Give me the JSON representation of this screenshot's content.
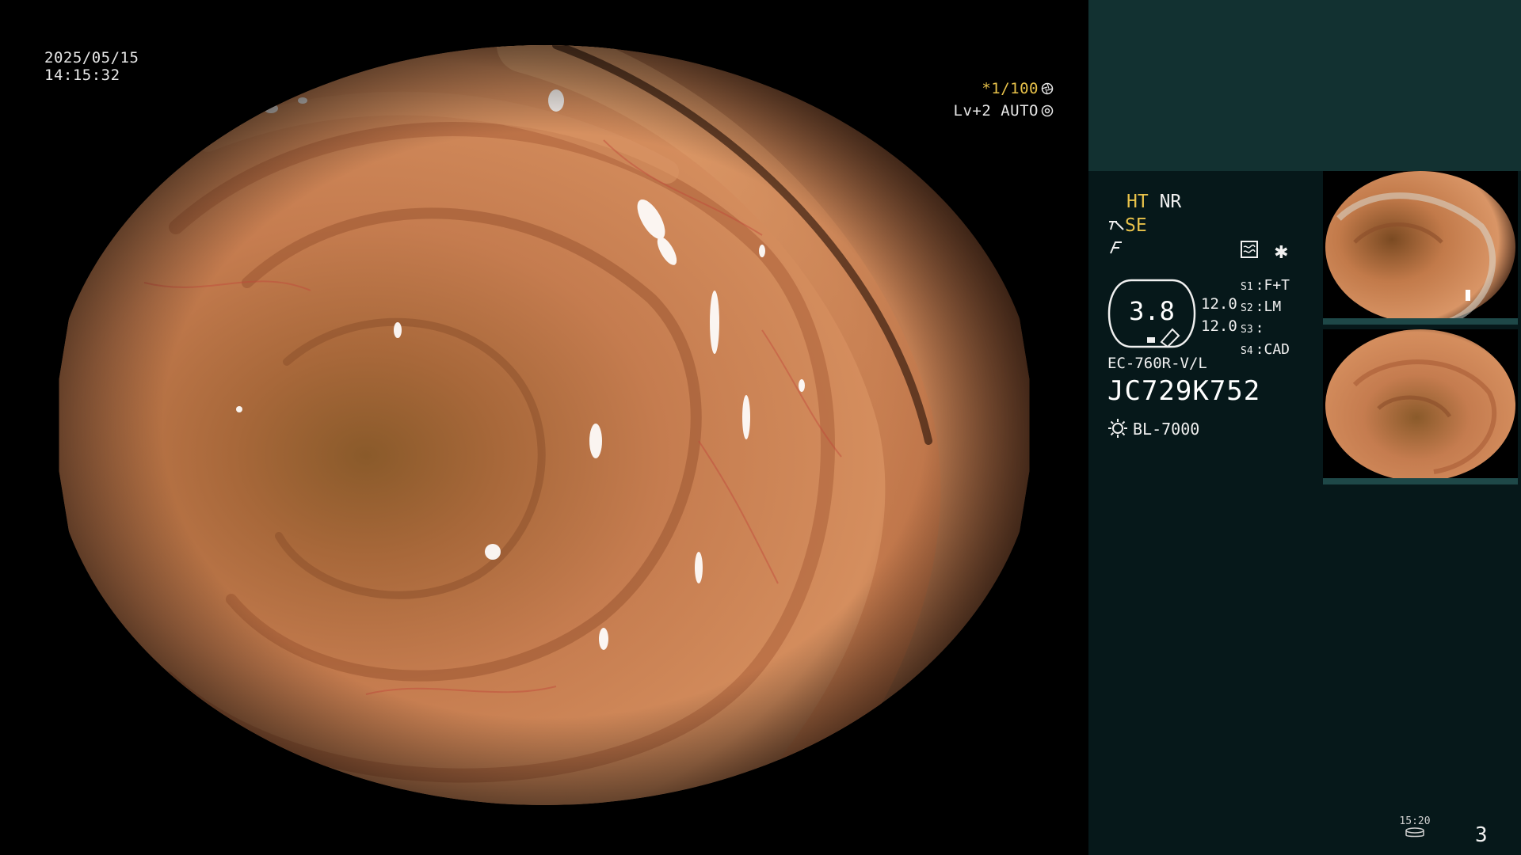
{
  "overlay": {
    "date": "2025/05/15",
    "time": "14:15:32",
    "shutter": "*1/100",
    "level": "Lv+2 AUTO"
  },
  "panel": {
    "mode_ht": "HT",
    "mode_nr": "NR",
    "mode_se": "SE",
    "brightness": "3.8",
    "levels": [
      "12.0",
      "12.0"
    ],
    "switches": [
      {
        "label": "S1",
        "value": "F+T"
      },
      {
        "label": "S2",
        "value": "LM"
      },
      {
        "label": "S3",
        "value": ""
      },
      {
        "label": "S4",
        "value": "CAD"
      }
    ],
    "scope_model": "EC-760R-V/L",
    "scope_serial": "JC729K752",
    "light_source": "BL-7000",
    "record_time": "15:20",
    "page_number": "3"
  },
  "icons": {
    "shutter": "aperture-icon",
    "auto": "gear-icon",
    "se": "scope-icon",
    "f": "freeze-icon",
    "waveform": "waveform-icon",
    "star": "asterisk-icon",
    "light": "sun-icon",
    "media": "storage-icon"
  },
  "colors": {
    "accent_yellow": "#e8c24a",
    "panel_bg": "#06181a",
    "panel_header": "#123131",
    "tissue": "#c77a4e"
  }
}
